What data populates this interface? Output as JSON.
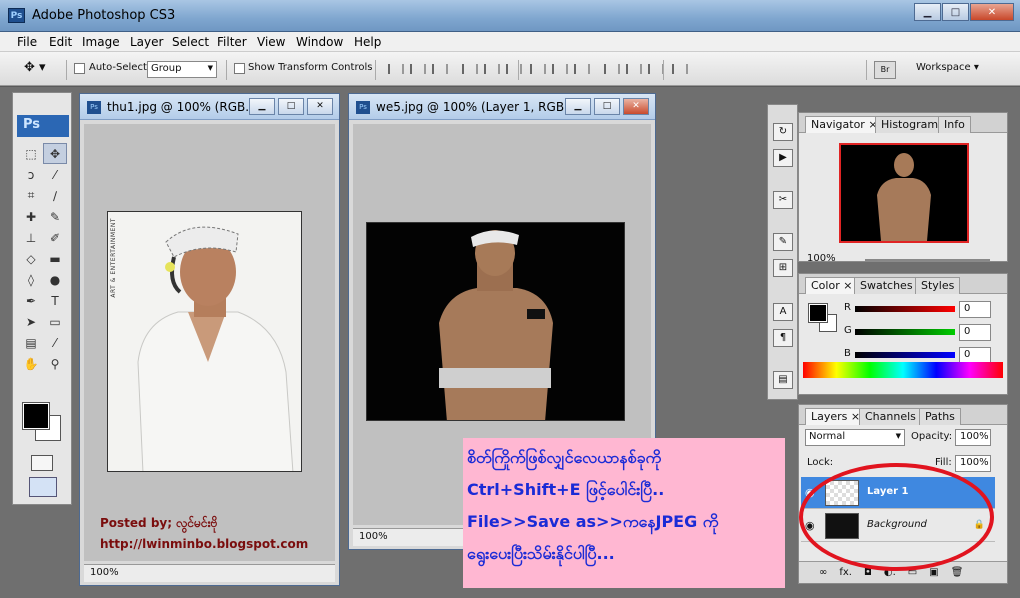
{
  "app": {
    "title": "Adobe Photoshop CS3",
    "logo": "Ps"
  },
  "window_buttons": {
    "minimize": "▁",
    "maximize": "□",
    "close": "✕"
  },
  "menu": [
    "File",
    "Edit",
    "Image",
    "Layer",
    "Select",
    "Filter",
    "View",
    "Window",
    "Help"
  ],
  "options": {
    "auto_select_label": "Auto-Select:",
    "auto_select_value": "Group",
    "transform_label": "Show Transform Controls",
    "workspace_label": "Workspace ▾"
  },
  "toolbox": {
    "logo": "Ps"
  },
  "documents": {
    "doc1": {
      "title": "thu1.jpg @ 100% (RGB...",
      "zoom": "100%",
      "watermark": "ART & ENTERTAINMENT"
    },
    "doc2": {
      "title": "we5.jpg @ 100% (Layer 1, RGB...",
      "zoom": "100%"
    }
  },
  "credit": {
    "posted": "Posted by; လွင်မင်းဗို",
    "url": "http://lwinminbo.blogspot.com"
  },
  "caption": {
    "line1": "စိတ်ကြိုက်ဖြစ်လျှင်လေယာနစ်ခုကို",
    "line2": "Ctrl+Shift+E ဖြင့်ပေါင်းပြီ..",
    "line3": "File>>Save as>>ကနေJPEG ကို",
    "line4": "ရွေးပေးပြီးသိမ်းနိုင်ပါပြီ..."
  },
  "navigator": {
    "tabs": [
      "Navigator ×",
      "Histogram",
      "Info"
    ],
    "zoom": "100%"
  },
  "color": {
    "tabs": [
      "Color ×",
      "Swatches",
      "Styles"
    ],
    "r_label": "R",
    "g_label": "G",
    "b_label": "B",
    "r": "0",
    "g": "0",
    "b": "0",
    "slider_colors": [
      "#ff0000",
      "#00c000",
      "#0000ff"
    ]
  },
  "layers": {
    "tabs": [
      "Layers ×",
      "Channels",
      "Paths"
    ],
    "blend_mode": "Normal",
    "opacity_label": "Opacity:",
    "opacity": "100%",
    "lock_label": "Lock:",
    "fill_label": "Fill:",
    "fill": "100%",
    "items": [
      {
        "name": "Layer 1",
        "selected": true
      },
      {
        "name": "Background",
        "selected": false
      }
    ],
    "footer_icons": [
      "∞",
      "fx.",
      "◘",
      "◐.",
      "▭",
      "▣",
      "🗑"
    ]
  }
}
